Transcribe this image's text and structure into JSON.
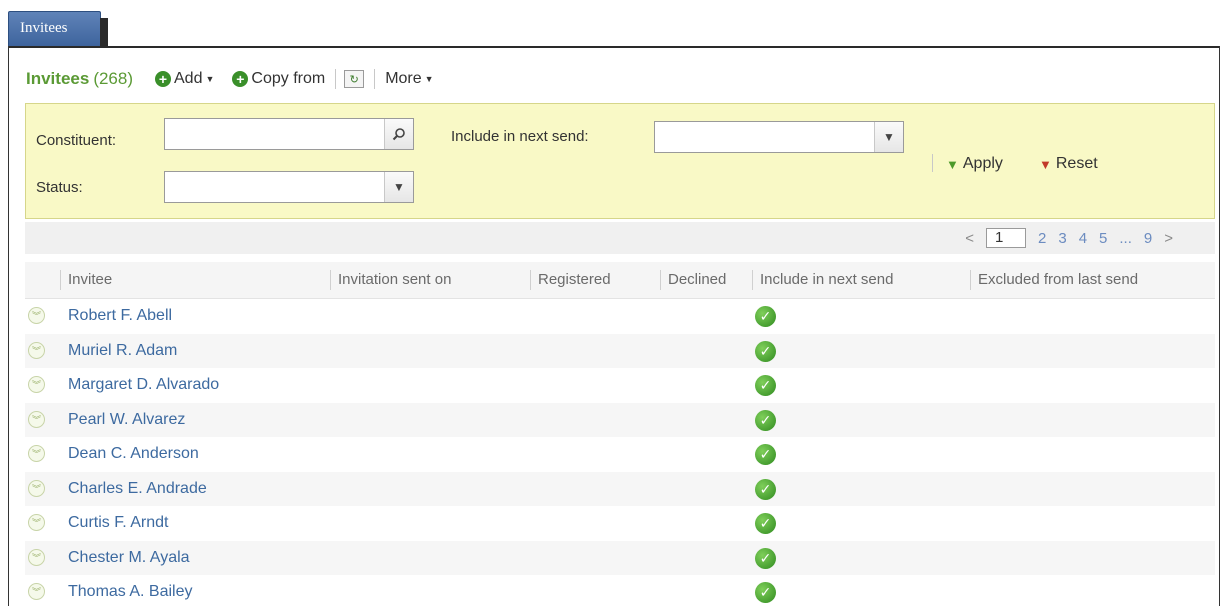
{
  "tab": {
    "label": "Invitees"
  },
  "toolbar": {
    "title": "Invitees",
    "count": "(268)",
    "add_label": "Add",
    "copy_label": "Copy from",
    "more_label": "More"
  },
  "filters": {
    "constituent_label": "Constituent:",
    "constituent_value": "",
    "status_label": "Status:",
    "status_value": "",
    "include_label": "Include in next send:",
    "include_value": "",
    "apply_label": "Apply",
    "reset_label": "Reset"
  },
  "pager": {
    "prev": "<",
    "current": "1",
    "pages": [
      "2",
      "3",
      "4",
      "5",
      "...",
      "9"
    ],
    "next": ">"
  },
  "table": {
    "columns": [
      "Invitee",
      "Invitation sent on",
      "Registered",
      "Declined",
      "Include in next send",
      "Excluded from last send"
    ],
    "rows": [
      {
        "invitee": "Robert F. Abell",
        "include_next_send": true
      },
      {
        "invitee": "Muriel R. Adam",
        "include_next_send": true
      },
      {
        "invitee": "Margaret D. Alvarado",
        "include_next_send": true
      },
      {
        "invitee": "Pearl W. Alvarez",
        "include_next_send": true
      },
      {
        "invitee": "Dean C. Anderson",
        "include_next_send": true
      },
      {
        "invitee": "Charles E. Andrade",
        "include_next_send": true
      },
      {
        "invitee": "Curtis F. Arndt",
        "include_next_send": true
      },
      {
        "invitee": "Chester M. Ayala",
        "include_next_send": true
      },
      {
        "invitee": "Thomas A. Bailey",
        "include_next_send": true
      }
    ]
  },
  "colors": {
    "accent_green": "#5b9a35",
    "link_blue": "#3d6aa0",
    "filter_bg": "#f9f9c6"
  },
  "icons": {
    "add": "plus-circle-icon",
    "copy": "plus-circle-icon",
    "refresh": "refresh-icon",
    "search": "magnifier-icon",
    "dropdown": "chevron-down-icon",
    "apply": "funnel-icon",
    "reset": "funnel-reset-icon",
    "row_expand": "double-chevron-down-icon",
    "check": "check-circle-icon"
  }
}
